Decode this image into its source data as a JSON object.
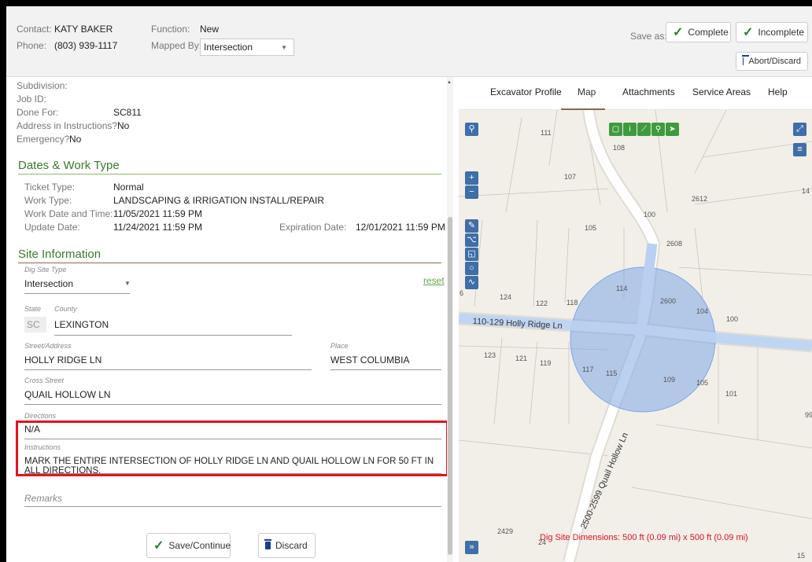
{
  "header": {
    "contact_label": "Contact:",
    "contact_value": "KATY BAKER",
    "phone_label": "Phone:",
    "phone_value": "(803) 939-1117",
    "function_label": "Function:",
    "function_value": "New",
    "mapped_by_label": "Mapped By:",
    "mapped_by_value": "Intersection",
    "save_as_label": "Save as:",
    "complete_label": "Complete",
    "incomplete_label": "Incomplete",
    "abort_label": "Abort/Discard"
  },
  "info": {
    "subdivision_label": "Subdivision:",
    "jobid_label": "Job ID:",
    "donefor_label": "Done For:",
    "donefor_value": "SC811",
    "address_label": "Address in Instructions?",
    "address_value": "No",
    "emergency_label": "Emergency?",
    "emergency_value": "No"
  },
  "dates": {
    "title": "Dates & Work Type",
    "ticket_type_label": "Ticket Type:",
    "ticket_type_value": "Normal",
    "work_type_label": "Work Type:",
    "work_type_value": "LANDSCAPING & IRRIGATION INSTALL/REPAIR",
    "work_date_label": "Work Date and Time:",
    "work_date_value": "11/05/2021 11:59 PM",
    "update_label": "Update Date:",
    "update_value": "11/24/2021 11:59 PM",
    "expiration_label": "Expiration Date:",
    "expiration_value": "12/01/2021 11:59 PM"
  },
  "site": {
    "title": "Site Information",
    "dig_site_type_label": "Dig Site Type",
    "dig_site_type_value": "Intersection",
    "reset_label": "reset",
    "state_label": "State",
    "county_label": "County",
    "state_value": "SC",
    "county_value": "LEXINGTON",
    "street_label": "Street/Address",
    "street_value": "HOLLY RIDGE LN",
    "place_label": "Place",
    "place_value": "WEST COLUMBIA",
    "cross_label": "Cross Street",
    "cross_value": "QUAIL HOLLOW LN",
    "directions_label": "Directions",
    "directions_value": "N/A",
    "instructions_label": "Instructions",
    "instructions_value": "MARK THE ENTIRE INTERSECTION OF HOLLY RIDGE LN AND QUAIL HOLLOW LN FOR 50 FT IN ALL DIRECTIONS.",
    "remarks_placeholder": "Remarks"
  },
  "actions": {
    "save_label": "Save/Continue",
    "discard_label": "Discard"
  },
  "map": {
    "tabs": [
      "Excavator Profile",
      "Map",
      "Attachments",
      "Service Areas",
      "Help"
    ],
    "active_tab": "Map",
    "road_label_1": "110-129 Holly Ridge Ln",
    "road_label_2": "2500-2599 Quail Hollow Ln",
    "dimensions": "Dig Site Dimensions: 500 ft (0.09 mi) x 500 ft (0.09 mi)",
    "lots": [
      "111",
      "108",
      "107",
      "14",
      "2612",
      "100",
      "105",
      "2608",
      "114",
      "124",
      "122",
      "118",
      "2600",
      "104",
      "100",
      "123",
      "121",
      "119",
      "117",
      "115",
      "109",
      "105",
      "101",
      "99",
      "2429",
      "24",
      "15",
      "6"
    ]
  }
}
